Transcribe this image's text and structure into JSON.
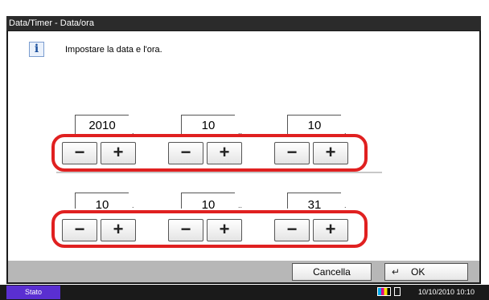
{
  "window": {
    "title": "Data/Timer - Data/ora"
  },
  "message": {
    "text": "Impostare la data e l'ora.",
    "icon": "info-icon"
  },
  "date": {
    "year": {
      "value": "2010",
      "unit": "."
    },
    "month": {
      "value": "10",
      "unit": ".."
    },
    "day": {
      "value": "10",
      "unit": "."
    }
  },
  "time": {
    "hour": {
      "value": "10",
      "unit": "."
    },
    "minute": {
      "value": "10",
      "unit": ".."
    },
    "second": {
      "value": "31",
      "unit": "."
    }
  },
  "controls": {
    "minus": "−",
    "plus": "+"
  },
  "actions": {
    "cancel_label": "Cancella",
    "ok_label": "OK",
    "ok_icon": "enter-icon"
  },
  "status": {
    "button_label": "Stato",
    "datetime": "10/10/2010 10:10"
  },
  "colors": {
    "highlight": "#e02020",
    "status_button": "#5a2fd1",
    "title_bar": "#2b2b2b"
  }
}
